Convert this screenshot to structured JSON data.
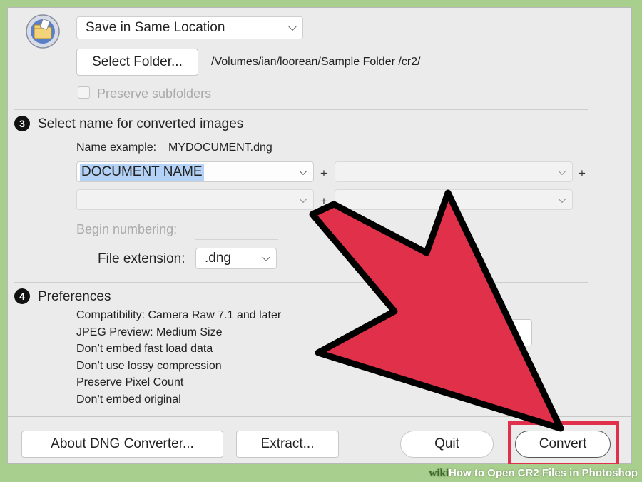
{
  "section2": {
    "location_select": "Save in Same Location",
    "select_folder_label": "Select Folder...",
    "folder_path": "/Volumes/ian/loorean/Sample Folder /cr2/",
    "preserve_subfolders_label": "Preserve subfolders"
  },
  "section3": {
    "number": "3",
    "title": "Select name for converted images",
    "name_example_label": "Name example:",
    "name_example_value": "MYDOCUMENT.dng",
    "name_select_1": "DOCUMENT NAME",
    "plus": "+",
    "begin_numbering_label": "Begin numbering:",
    "file_extension_label": "File extension:",
    "file_extension_value": ".dng"
  },
  "section4": {
    "number": "4",
    "title": "Preferences",
    "items": [
      "Compatibility: Camera Raw 7.1 and later",
      "JPEG Preview: Medium Size",
      "Don’t embed fast load data",
      "Don’t use lossy compression",
      "Preserve Pixel Count",
      "Don’t embed original"
    ]
  },
  "buttons": {
    "about": "About DNG Converter...",
    "extract": "Extract...",
    "quit": "Quit",
    "convert": "Convert"
  },
  "watermark": {
    "wiki": "wiki",
    "title": "How to Open CR2 Files in Photoshop"
  },
  "colors": {
    "arrow": "#e0304a",
    "highlight_box": "#e0304a",
    "selection": "#b3d2f5",
    "background": "#a9cf8e"
  }
}
